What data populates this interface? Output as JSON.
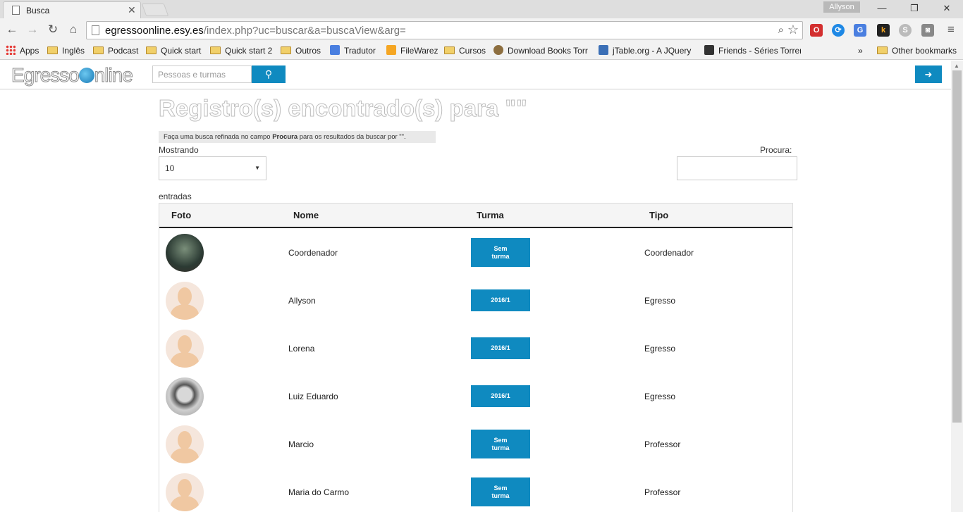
{
  "browser": {
    "tab_title": "Busca",
    "profile_name": "Allyson",
    "url_host": "egressoonline.esy.es",
    "url_path": "/index.php?uc=buscar&a=buscaView&arg=",
    "bookmarks": [
      "Apps",
      "Inglês",
      "Podcast",
      "Quick start",
      "Quick start 2",
      "Outros",
      "Tradutor",
      "FileWarez",
      "Cursos",
      "Download Books Torr",
      "jTable.org - A JQuery",
      "Friends - Séries Torren",
      "Other bookmarks"
    ],
    "bookmarks_overflow": "»"
  },
  "site": {
    "logo_text": "Egresso",
    "logo_text_2": "nline",
    "search_placeholder": "Pessoas e turmas"
  },
  "page": {
    "title": "Registro(s) encontrado(s) para \"\"",
    "hint_prefix": "Faça uma busca refinada no campo ",
    "hint_bold": "Procura",
    "hint_suffix": " para os resultados da buscar por \"\".",
    "showing_label": "Mostrando",
    "page_size": "10",
    "entries_label": "entradas",
    "search_label": "Procura:"
  },
  "table": {
    "headers": [
      "Foto",
      "Nome",
      "Turma",
      "Tipo"
    ],
    "rows": [
      {
        "nome": "Coordenador",
        "turma": "Sem turma",
        "tipo": "Coordenador"
      },
      {
        "nome": "Allyson",
        "turma": "2016/1",
        "tipo": "Egresso"
      },
      {
        "nome": "Lorena",
        "turma": "2016/1",
        "tipo": "Egresso"
      },
      {
        "nome": "Luiz Eduardo",
        "turma": "2016/1",
        "tipo": "Egresso"
      },
      {
        "nome": "Marcio",
        "turma": "Sem turma",
        "tipo": "Professor"
      },
      {
        "nome": "Maria do Carmo",
        "turma": "Sem turma",
        "tipo": "Professor"
      }
    ]
  },
  "colors": {
    "accent": "#0f8ac0"
  }
}
